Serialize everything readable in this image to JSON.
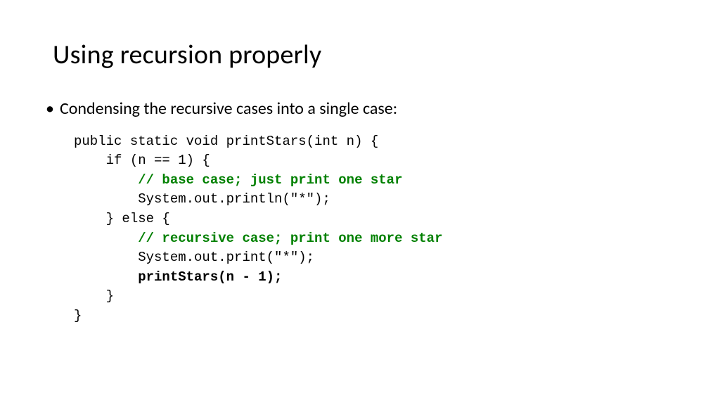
{
  "title": "Using recursion properly",
  "bullet": {
    "dot": "•",
    "text": "Condensing the recursive cases into a single case:"
  },
  "code": {
    "l1": "public static void printStars(int n) {",
    "l2": "    if (n == 1) {",
    "l3": "        // base case; just print one star",
    "l4": "        System.out.println(\"*\");",
    "l5": "    } else {",
    "l6": "        // recursive case; print one more star",
    "l7": "        System.out.print(\"*\");",
    "l8": "        printStars(n - 1);",
    "l9": "    }",
    "l10": "}"
  }
}
